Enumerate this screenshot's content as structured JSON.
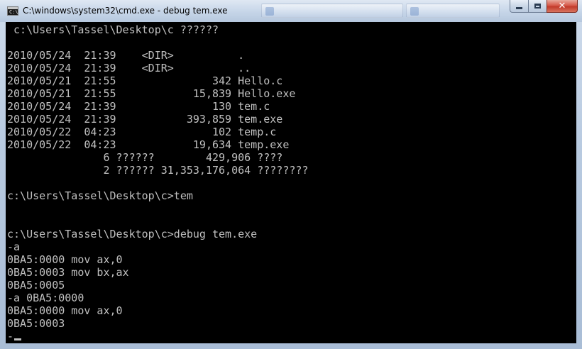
{
  "window": {
    "title": "C:\\windows\\system32\\cmd.exe - debug  tem.exe",
    "icon": "cmd-icon",
    "icon_text": "C:\\",
    "buttons": {
      "minimize": "minimize-icon",
      "maximize": "maximize-icon",
      "close": "close-icon"
    }
  },
  "colors": {
    "console_bg": "#000000",
    "console_fg": "#c0c0c0",
    "close_red": "#c9412f"
  },
  "console": {
    "lines": [
      " c:\\Users\\Tassel\\Desktop\\c ??????",
      "",
      "2010/05/24  21:39    <DIR>          .",
      "2010/05/24  21:39    <DIR>          ..",
      "2010/05/21  21:55               342 Hello.c",
      "2010/05/21  21:55            15,839 Hello.exe",
      "2010/05/24  21:39               130 tem.c",
      "2010/05/24  21:39           393,859 tem.exe",
      "2010/05/22  04:23               102 temp.c",
      "2010/05/22  04:23            19,634 temp.exe",
      "               6 ??????        429,906 ????",
      "               2 ?????? 31,353,176,064 ????????",
      "",
      "c:\\Users\\Tassel\\Desktop\\c>tem",
      "",
      "",
      "c:\\Users\\Tassel\\Desktop\\c>debug tem.exe",
      "-a",
      "0BA5:0000 mov ax,0",
      "0BA5:0003 mov bx,ax",
      "0BA5:0005",
      "-a 0BA5:0000",
      "0BA5:0000 mov ax,0",
      "0BA5:0003",
      "-"
    ]
  }
}
